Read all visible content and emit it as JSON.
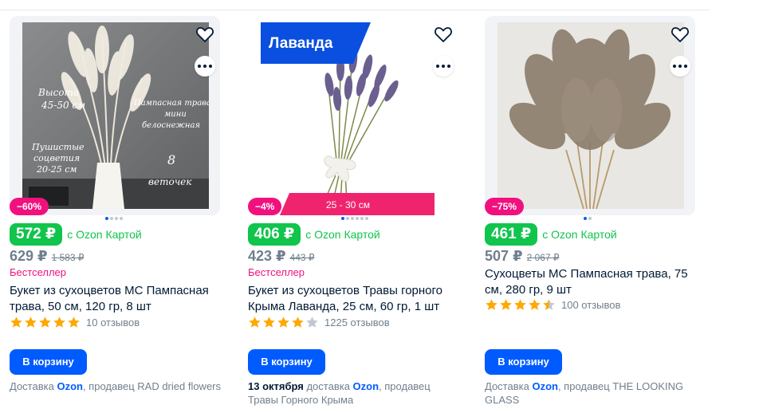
{
  "cards": [
    {
      "discount": "−60%",
      "ozon_price": "572 ₽",
      "ozon_card_label": "с Ozon Картой",
      "price": "629 ₽",
      "old_price": "1 583 ₽",
      "label": "Бестселлер",
      "title": "Букет из сухоцветов MC Пампасная трава, 50 см, 120 гр, 8 шт",
      "stars": 5,
      "reviews": "10 отзывов",
      "cart_button": "В корзину",
      "delivery_prefix": "Доставка ",
      "delivery_ozon": "Ozon",
      "delivery_suffix": ", продавец RAD dried flowers",
      "photo_text": [
        "Высота",
        "45-50 см",
        "Пампасная трава",
        "мини",
        "белоснежная",
        "Пушистые",
        "соцветия",
        "20-25 см",
        "8",
        "веточек"
      ]
    },
    {
      "discount": "−4%",
      "ozon_price": "406 ₽",
      "ozon_card_label": "с Ozon Картой",
      "price": "423 ₽",
      "old_price": "443 ₽",
      "label": "Бестселлер",
      "title": "Букет из сухоцветов Травы горного Крыма Лаванда, 25 см, 60 гр, 1 шт",
      "stars": 4,
      "reviews": "1225 отзывов",
      "cart_button": "В корзину",
      "delivery_date": "13 октября",
      "delivery_prefix": " доставка ",
      "delivery_ozon": "Ozon",
      "delivery_suffix": ", продавец Травы Горного Крыма",
      "image_tag": "Лаванда",
      "image_size": "25 - 30 см"
    },
    {
      "discount": "−75%",
      "ozon_price": "461 ₽",
      "ozon_card_label": "с Ozon Картой",
      "price": "507 ₽",
      "old_price": "2 067 ₽",
      "title": "Сухоцветы MC Пампасная трава, 75 см, 280 гр, 9 шт",
      "stars": 4.5,
      "reviews": "100 отзывов",
      "cart_button": "В корзину",
      "delivery_prefix": "Доставка ",
      "delivery_ozon": "Ozon",
      "delivery_suffix": ", продавец THE LOOKING GLASS"
    }
  ],
  "colors": {
    "accent": "#005bff",
    "ozon_green": "#10c44c",
    "discount_pink": "#f1117e",
    "star": "#ffa800",
    "star_empty": "#c0c7d1"
  }
}
